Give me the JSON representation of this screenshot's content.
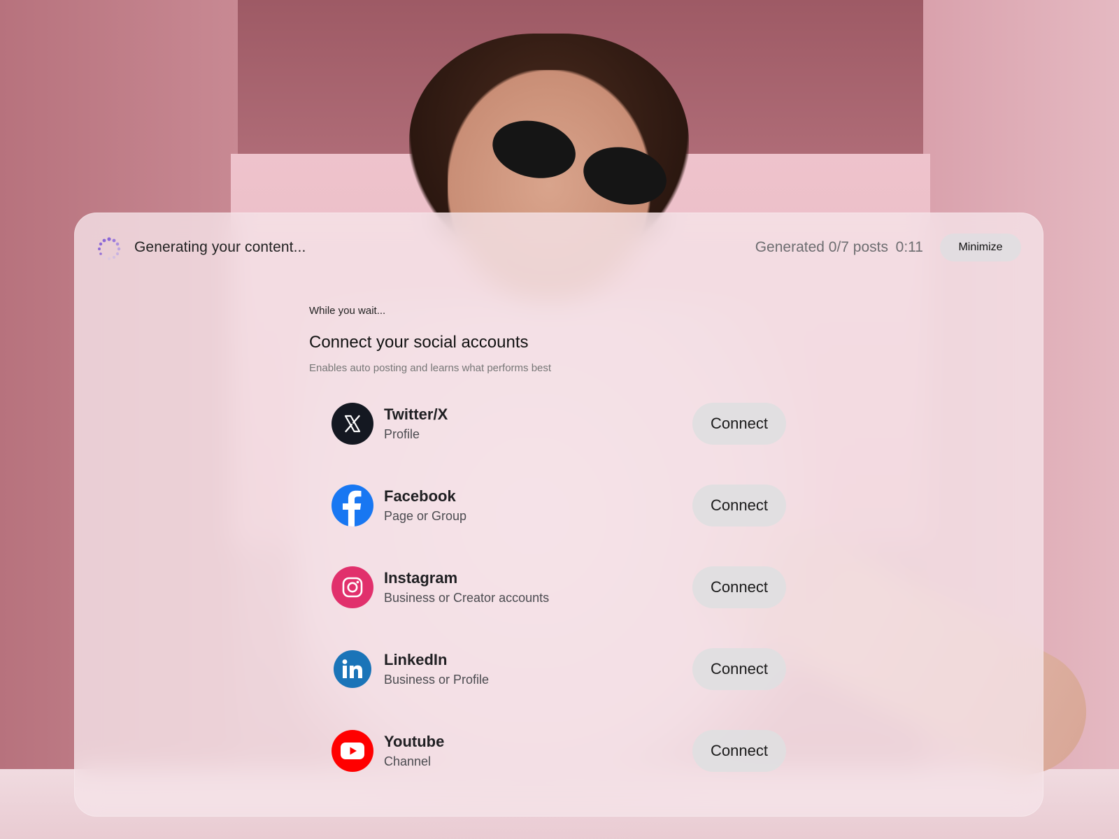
{
  "header": {
    "status_text": "Generating your content...",
    "generated_text": "Generated 0/7 posts",
    "timer": "0:11",
    "minimize_label": "Minimize"
  },
  "main": {
    "wait_text": "While you wait...",
    "heading": "Connect your social accounts",
    "subtext": "Enables auto posting and learns what performs best",
    "accounts": [
      {
        "name": "Twitter/X",
        "subtitle": "Profile",
        "button": "Connect",
        "icon": "x-logo-icon",
        "color": "#141821"
      },
      {
        "name": "Facebook",
        "subtitle": "Page or Group",
        "button": "Connect",
        "icon": "facebook-logo-icon",
        "color": "#1877f2"
      },
      {
        "name": "Instagram",
        "subtitle": "Business or Creator accounts",
        "button": "Connect",
        "icon": "instagram-logo-icon",
        "color": "#e1306c"
      },
      {
        "name": "LinkedIn",
        "subtitle": "Business or Profile",
        "button": "Connect",
        "icon": "linkedin-logo-icon",
        "color": "#0a66c2"
      },
      {
        "name": "Youtube",
        "subtitle": "Channel",
        "button": "Connect",
        "icon": "youtube-logo-icon",
        "color": "#ff0000"
      }
    ]
  },
  "colors": {
    "spinner_accent": "#8b67d6",
    "panel_bg": "#f5e4e9",
    "button_bg": "#e0dfe0"
  }
}
